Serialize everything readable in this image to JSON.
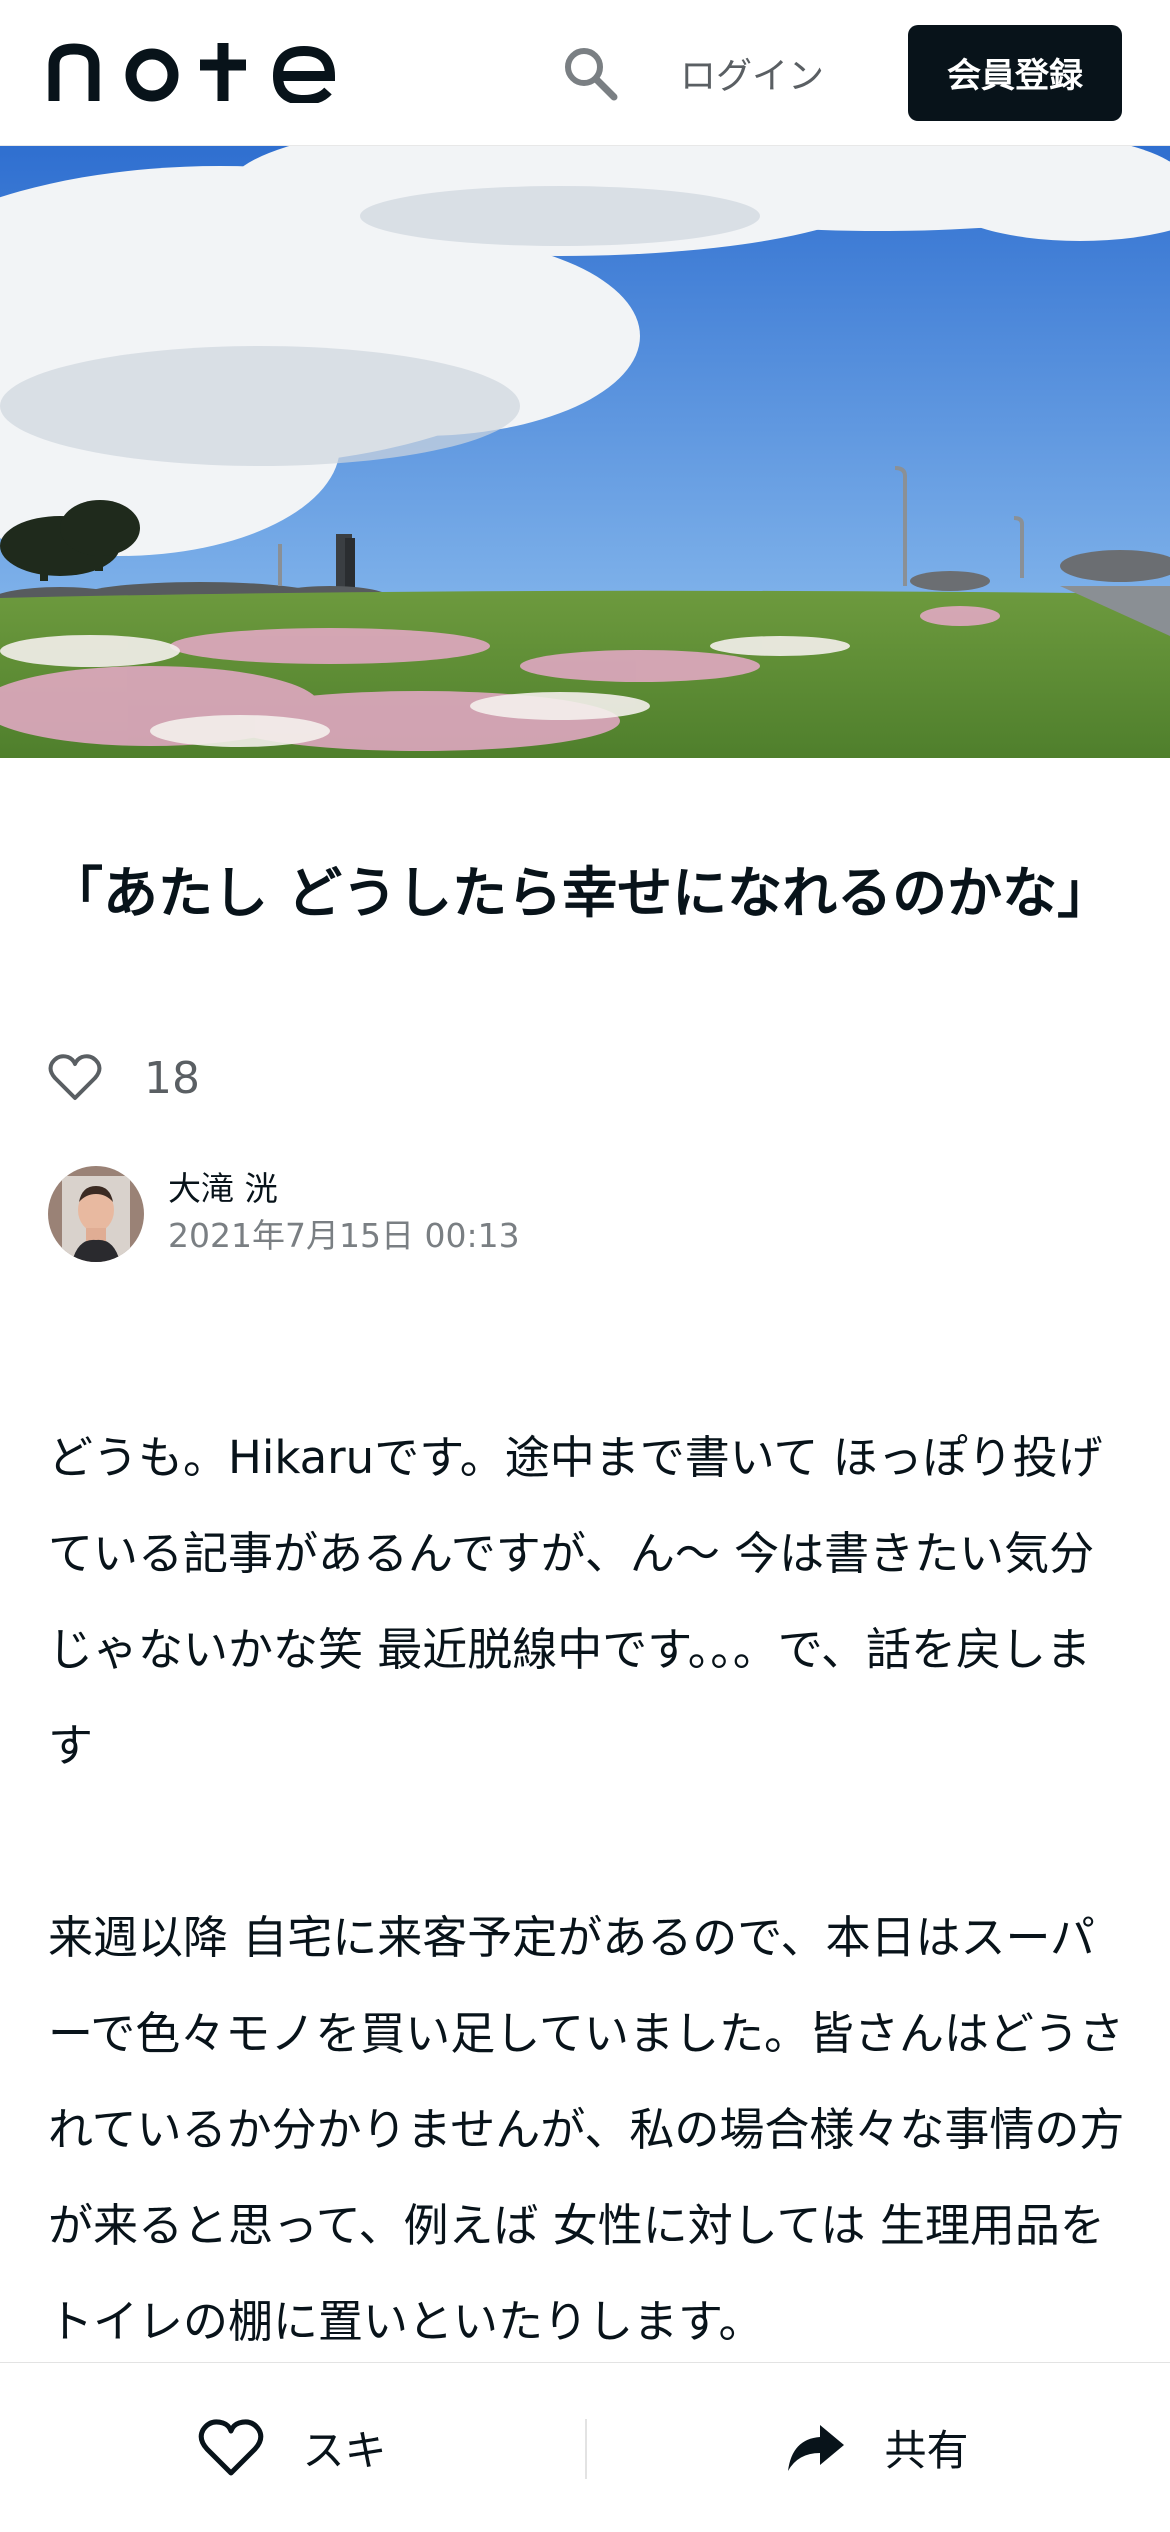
{
  "header": {
    "logo_text": "note",
    "login_label": "ログイン",
    "signup_label": "会員登録"
  },
  "article": {
    "title": "「あたし どうしたら幸せになれるのかな」",
    "like_count": "18",
    "author_name": "大滝 洸",
    "post_date": "2021年7月15日 00:13",
    "paragraphs": [
      "どうも。Hikaruです。途中まで書いて ほっぽり投げている記事があるんですが、ん〜 今は書きたい気分じゃないかな笑 最近脱線中です。。。で、話を戻します",
      "来週以降 自宅に来客予定があるので、本日はスーパーで色々モノを買い足していました。皆さんはどうされているか分かりませんが、私の場合様々な事情の方が来ると思って、例えば 女性に対しては 生理用品をトイレの棚に置いといたりします。"
    ]
  },
  "bottom_bar": {
    "like_label": "スキ",
    "share_label": "共有"
  },
  "icons": {
    "search": "search-icon",
    "heart": "heart-icon",
    "share": "share-arrow-icon"
  },
  "colors": {
    "text": "#08131a",
    "muted": "#5a5f63",
    "button_bg": "#08131a"
  }
}
